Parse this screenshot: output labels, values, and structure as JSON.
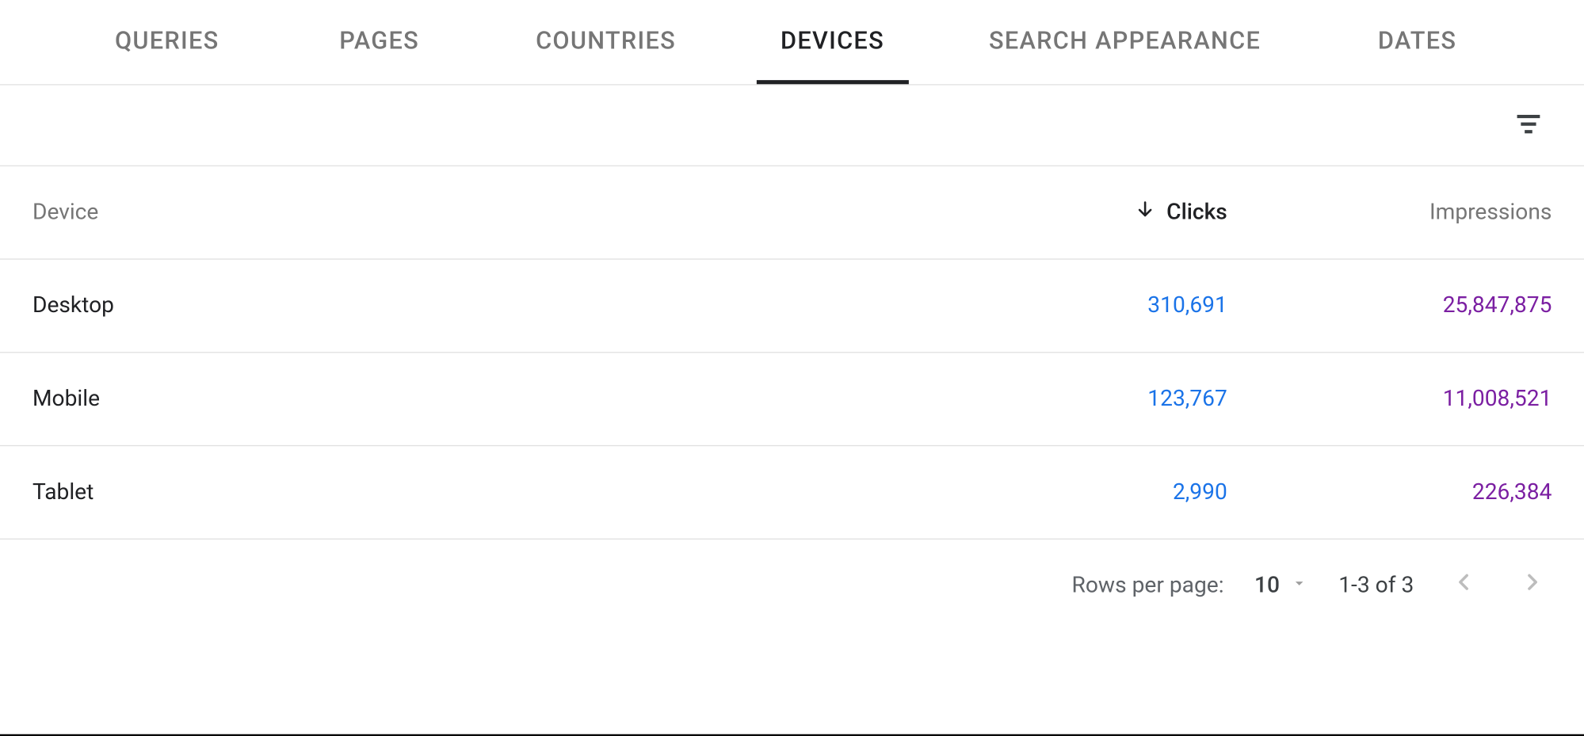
{
  "tabs": [
    {
      "label": "QUERIES",
      "active": false
    },
    {
      "label": "PAGES",
      "active": false
    },
    {
      "label": "COUNTRIES",
      "active": false
    },
    {
      "label": "DEVICES",
      "active": true
    },
    {
      "label": "SEARCH APPEARANCE",
      "active": false
    },
    {
      "label": "DATES",
      "active": false
    }
  ],
  "columns": {
    "device": "Device",
    "clicks": "Clicks",
    "impressions": "Impressions"
  },
  "sort": {
    "column": "clicks",
    "direction": "desc"
  },
  "rows": [
    {
      "device": "Desktop",
      "clicks": "310,691",
      "impressions": "25,847,875"
    },
    {
      "device": "Mobile",
      "clicks": "123,767",
      "impressions": "11,008,521"
    },
    {
      "device": "Tablet",
      "clicks": "2,990",
      "impressions": "226,384"
    }
  ],
  "pagination": {
    "rows_per_page_label": "Rows per page:",
    "rows_per_page_value": "10",
    "range_text": "1-3 of 3"
  },
  "colors": {
    "clicks": "#1a73e8",
    "impressions": "#7b1fa2"
  }
}
